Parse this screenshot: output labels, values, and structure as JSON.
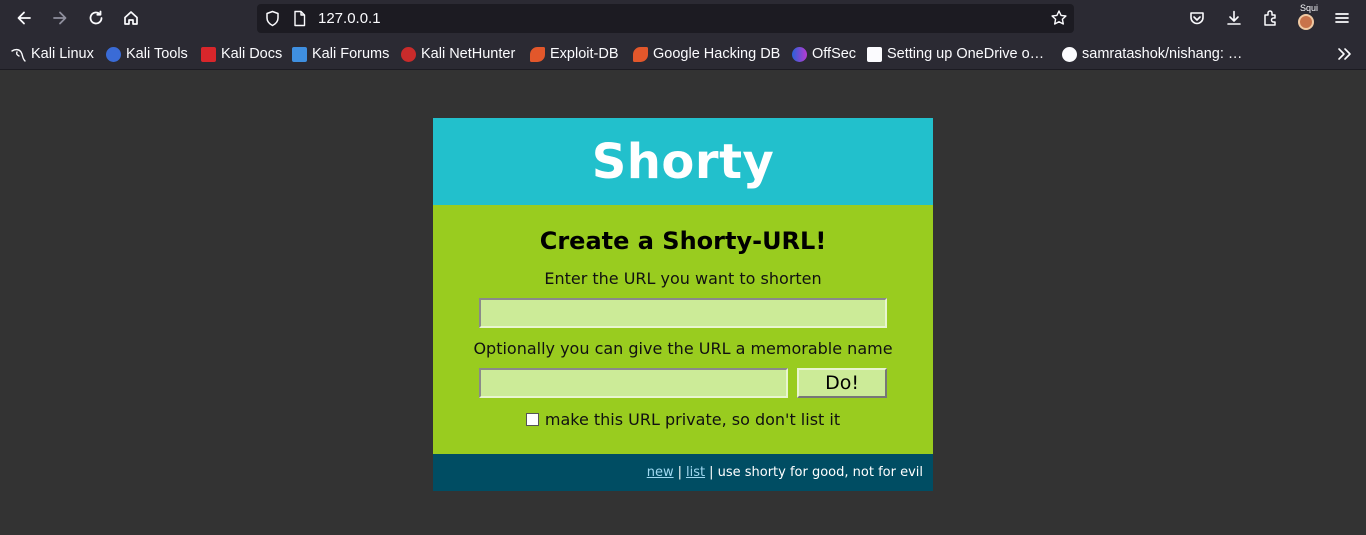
{
  "browser": {
    "url": "127.0.0.1",
    "profile_label": "Squi",
    "bookmarks": [
      {
        "label": "Kali Linux",
        "icon": "kali-dragon-icon"
      },
      {
        "label": "Kali Tools",
        "icon": "kali-tools-icon"
      },
      {
        "label": "Kali Docs",
        "icon": "kali-docs-icon"
      },
      {
        "label": "Kali Forums",
        "icon": "kali-forums-icon"
      },
      {
        "label": "Kali NetHunter",
        "icon": "nethunter-icon"
      },
      {
        "label": "Exploit-DB",
        "icon": "exploit-db-icon"
      },
      {
        "label": "Google Hacking DB",
        "icon": "ghdb-icon"
      },
      {
        "label": "OffSec",
        "icon": "offsec-icon"
      },
      {
        "label": "Setting up OneDrive o…",
        "icon": "onedrive-page-icon"
      },
      {
        "label": "samratashok/nishang: …",
        "icon": "github-icon"
      }
    ]
  },
  "shorty": {
    "title": "Shorty",
    "heading": "Create a Shorty-URL!",
    "url_prompt": "Enter the URL you want to shorten",
    "url_value": "",
    "name_prompt": "Optionally you can give the URL a memorable name",
    "name_value": "",
    "submit_label": "Do!",
    "private_label": "make this URL private, so don't list it",
    "private_checked": false,
    "footer": {
      "new_link": "new",
      "separator": "|",
      "list_link": "list",
      "tagline": "| use shorty for good, not for evil"
    }
  },
  "colors": {
    "header": "#22c0cc",
    "body": "#99cc1f",
    "footer": "#004d63",
    "page_bg": "#333333"
  }
}
